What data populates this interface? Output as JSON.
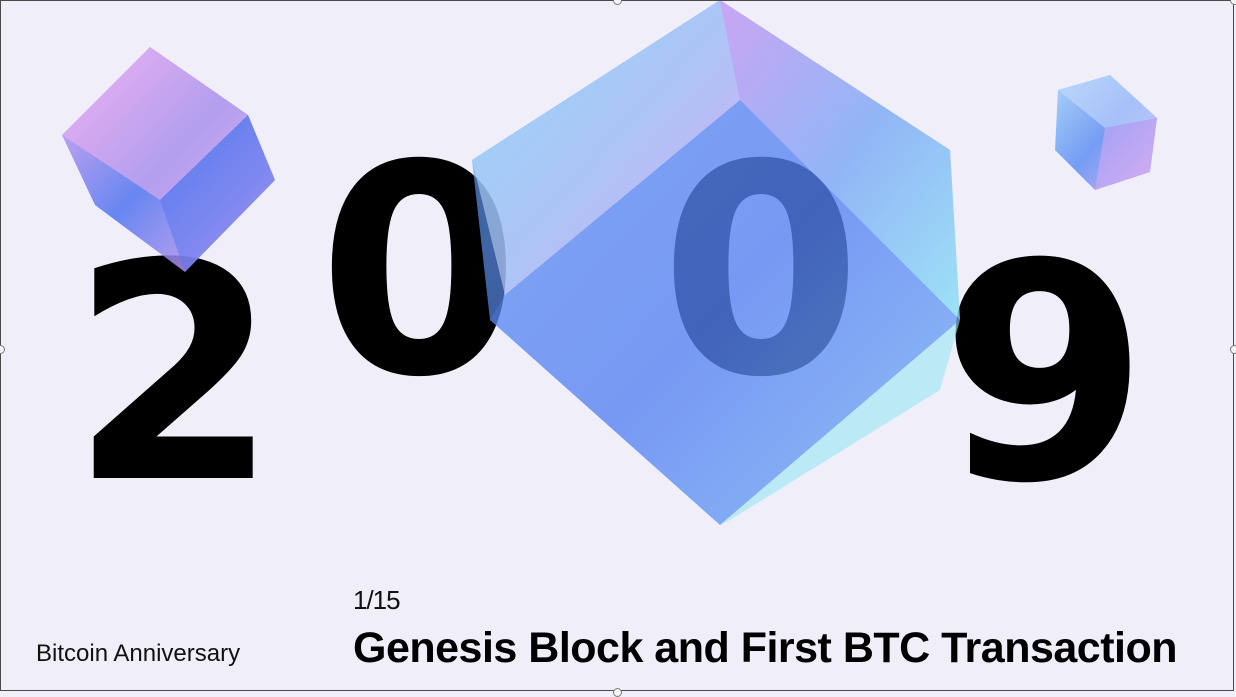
{
  "slide": {
    "year_digits": [
      "2",
      "0",
      "0",
      "9"
    ],
    "counter": "1/15",
    "title": "Genesis Block and First BTC Transaction",
    "subtitle": "Bitcoin Anniversary"
  },
  "icons": {
    "large_cube": "glass-cube-icon",
    "small_cube_left": "glass-cube-icon",
    "small_cube_right": "glass-cube-icon"
  },
  "colors": {
    "background": "#f0eff9",
    "text": "#000000",
    "cube_blue": "#4f7cf0",
    "cube_cyan": "#8fe3ff",
    "cube_pink": "#ea9cf2"
  }
}
